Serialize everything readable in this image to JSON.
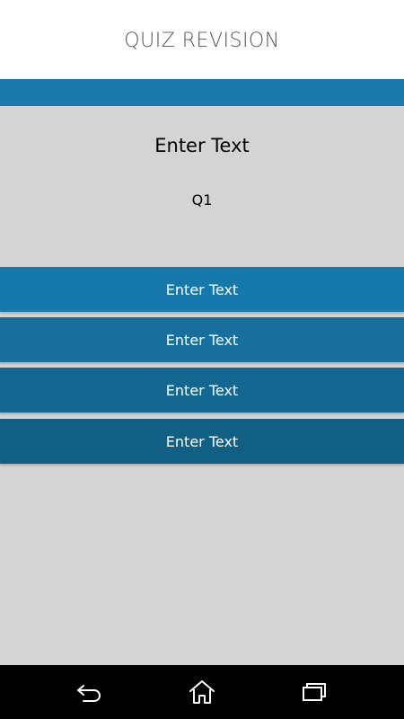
{
  "app": {
    "title": "QUIZ REVISION"
  },
  "colors": {
    "accent": "#197aab",
    "background": "#d4d4d4",
    "header_bg": "#ffffff",
    "navbar_bg": "#000000"
  },
  "question": {
    "text": "Enter Text",
    "number": "Q1"
  },
  "answers": [
    {
      "label": "Enter Text"
    },
    {
      "label": "Enter Text"
    },
    {
      "label": "Enter Text"
    },
    {
      "label": "Enter Text"
    }
  ],
  "navbar": {
    "back_icon": "back-icon",
    "home_icon": "home-icon",
    "recents_icon": "recents-icon"
  }
}
